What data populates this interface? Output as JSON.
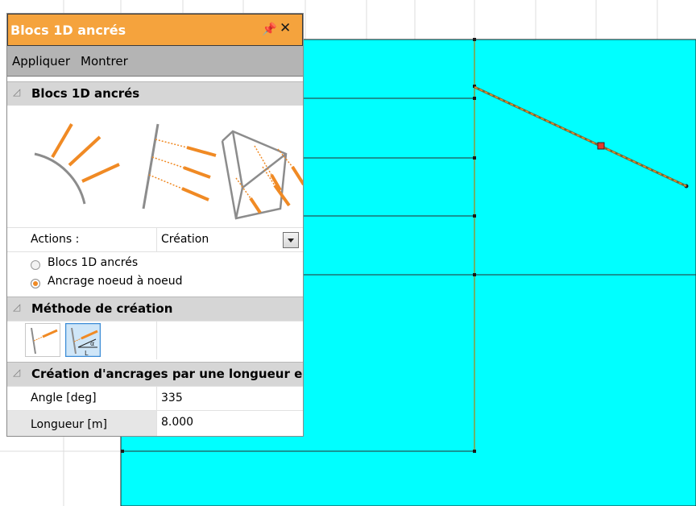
{
  "panel": {
    "title": "Blocs 1D ancrés",
    "pin_icon": "pin-icon",
    "close_icon": "close-icon",
    "accent_color": "#f5a33d",
    "menu": {
      "apply_label": "Appliquer",
      "show_label": "Montrer"
    },
    "section_anchors": {
      "label": "Blocs 1D ancrés",
      "actions_label": "Actions :",
      "actions_value": "Création",
      "options": [
        {
          "label": "Blocs 1D ancrés",
          "selected": false
        },
        {
          "label": "Ancrage noeud à noeud",
          "selected": true
        }
      ]
    },
    "section_method": {
      "label": "Méthode de création"
    },
    "section_length": {
      "label": "Création d'ancrages par une longueur e",
      "fields": [
        {
          "label": "Angle [deg]",
          "value": "335"
        },
        {
          "label": "Longueur [m]",
          "value": "8.000"
        }
      ]
    }
  },
  "canvas": {
    "soil_color": "#00ffff",
    "anchor_color": "#f08a24"
  }
}
